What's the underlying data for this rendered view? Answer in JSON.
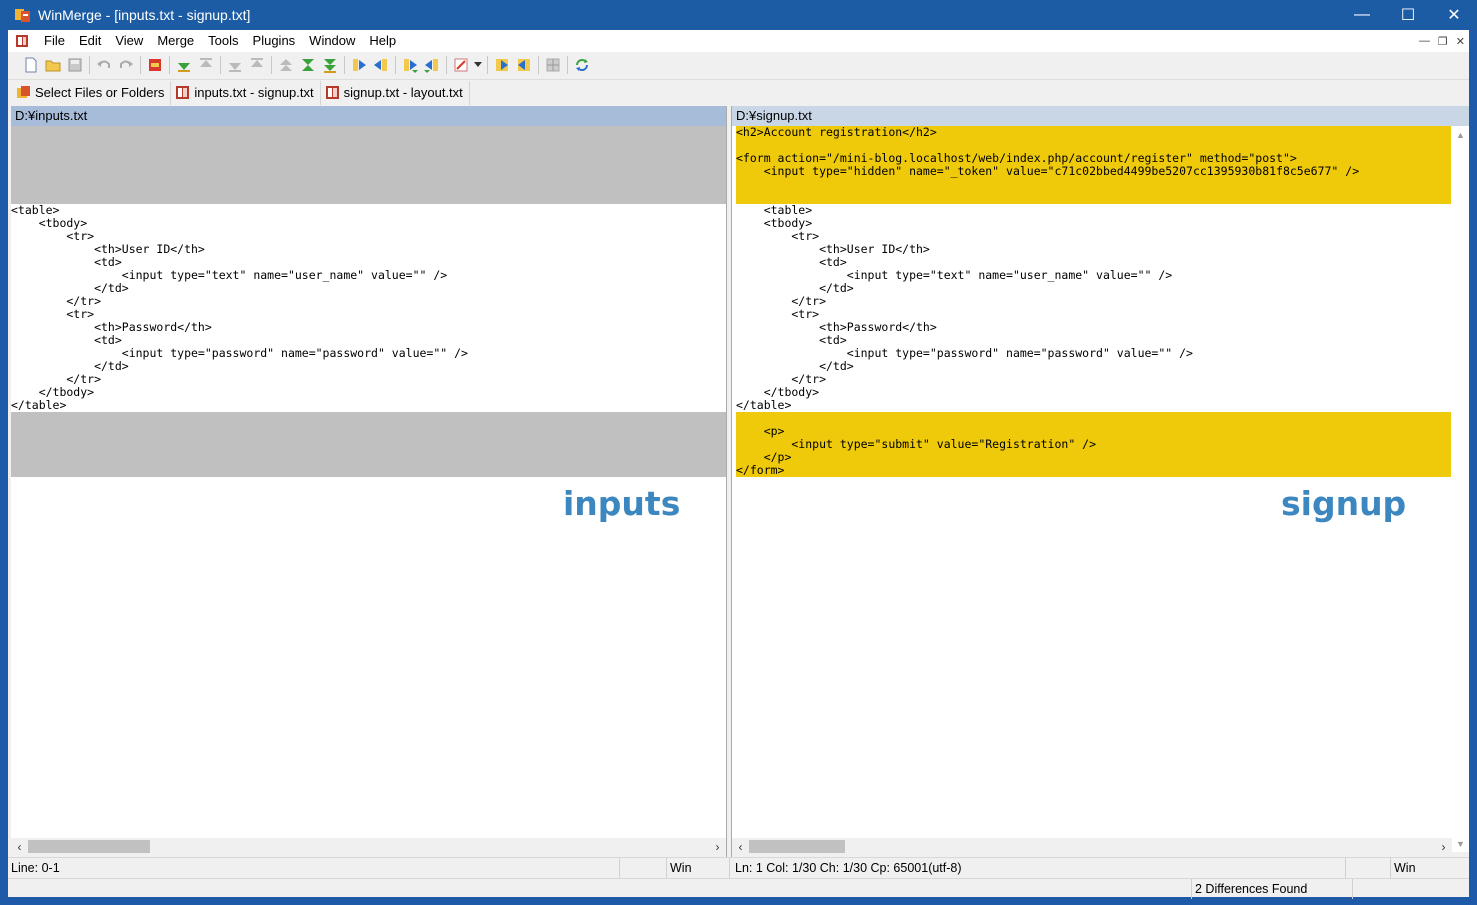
{
  "window": {
    "title": "WinMerge - [inputs.txt - signup.txt]",
    "controls": [
      "minimize",
      "maximize",
      "close"
    ]
  },
  "menu": [
    "File",
    "Edit",
    "View",
    "Merge",
    "Tools",
    "Plugins",
    "Window",
    "Help"
  ],
  "toolbar_icons": [
    "new-document-icon",
    "open-folder-icon",
    "save-icon",
    "undo-icon",
    "redo-icon",
    "options-icon",
    "next-diff-icon",
    "prev-diff-icon",
    "last-diff-icon",
    "first-diff-icon",
    "first-diff-alt-icon",
    "current-diff-icon",
    "last-diff-alt-icon",
    "copy-right-icon",
    "copy-left-icon",
    "copy-right-advance-icon",
    "copy-left-advance-icon",
    "all-right-icon",
    "all-left-icon",
    "auto-merge-icon",
    "refresh-icon"
  ],
  "tabs": [
    {
      "label": "Select Files or Folders",
      "icon": "open-files-icon"
    },
    {
      "label": "inputs.txt - signup.txt",
      "icon": "diff-document-icon"
    },
    {
      "label": "signup.txt - layout.txt",
      "icon": "diff-document-icon"
    }
  ],
  "left_pane": {
    "path": "D:¥inputs.txt",
    "label": "inputs",
    "lines": [
      {
        "t": "",
        "k": "gap"
      },
      {
        "t": "",
        "k": "gap"
      },
      {
        "t": "",
        "k": "gap"
      },
      {
        "t": "",
        "k": "gap"
      },
      {
        "t": "",
        "k": "gap"
      },
      {
        "t": "",
        "k": "gap"
      },
      {
        "t": "<table>",
        "k": ""
      },
      {
        "t": "    <tbody>",
        "k": ""
      },
      {
        "t": "        <tr>",
        "k": ""
      },
      {
        "t": "            <th>User ID</th>",
        "k": ""
      },
      {
        "t": "            <td>",
        "k": ""
      },
      {
        "t": "                <input type=\"text\" name=\"user_name\" value=\"\" />",
        "k": ""
      },
      {
        "t": "            </td>",
        "k": ""
      },
      {
        "t": "        </tr>",
        "k": ""
      },
      {
        "t": "        <tr>",
        "k": ""
      },
      {
        "t": "            <th>Password</th>",
        "k": ""
      },
      {
        "t": "            <td>",
        "k": ""
      },
      {
        "t": "                <input type=\"password\" name=\"password\" value=\"\" />",
        "k": ""
      },
      {
        "t": "            </td>",
        "k": ""
      },
      {
        "t": "        </tr>",
        "k": ""
      },
      {
        "t": "    </tbody>",
        "k": ""
      },
      {
        "t": "</table>",
        "k": ""
      },
      {
        "t": "",
        "k": "gap"
      },
      {
        "t": "",
        "k": "gap"
      },
      {
        "t": "",
        "k": "gap"
      },
      {
        "t": "",
        "k": "gap"
      },
      {
        "t": "",
        "k": "gap"
      }
    ]
  },
  "right_pane": {
    "path": "D:¥signup.txt",
    "label": "signup",
    "lines": [
      {
        "t": "<h2>Account registration</h2>",
        "k": "diff"
      },
      {
        "t": "",
        "k": "diff"
      },
      {
        "t": "<form action=\"/mini-blog.localhost/web/index.php/account/register\" method=\"post\">",
        "k": "diff"
      },
      {
        "t": "    <input type=\"hidden\" name=\"_token\" value=\"c71c02bbed4499be5207cc1395930b81f8c5e677\" />",
        "k": "diff"
      },
      {
        "t": "",
        "k": "diff"
      },
      {
        "t": "",
        "k": "diff"
      },
      {
        "t": "    <table>",
        "k": ""
      },
      {
        "t": "    <tbody>",
        "k": ""
      },
      {
        "t": "        <tr>",
        "k": ""
      },
      {
        "t": "            <th>User ID</th>",
        "k": ""
      },
      {
        "t": "            <td>",
        "k": ""
      },
      {
        "t": "                <input type=\"text\" name=\"user_name\" value=\"\" />",
        "k": ""
      },
      {
        "t": "            </td>",
        "k": ""
      },
      {
        "t": "        </tr>",
        "k": ""
      },
      {
        "t": "        <tr>",
        "k": ""
      },
      {
        "t": "            <th>Password</th>",
        "k": ""
      },
      {
        "t": "            <td>",
        "k": ""
      },
      {
        "t": "                <input type=\"password\" name=\"password\" value=\"\" />",
        "k": ""
      },
      {
        "t": "            </td>",
        "k": ""
      },
      {
        "t": "        </tr>",
        "k": ""
      },
      {
        "t": "    </tbody>",
        "k": ""
      },
      {
        "t": "</table>",
        "k": ""
      },
      {
        "t": "",
        "k": "diff"
      },
      {
        "t": "    <p>",
        "k": "diff"
      },
      {
        "t": "        <input type=\"submit\" value=\"Registration\" />",
        "k": "diff"
      },
      {
        "t": "    </p>",
        "k": "diff"
      },
      {
        "t": "</form>",
        "k": "diff"
      }
    ]
  },
  "status": {
    "left_line": "Line: 0-1",
    "left_eol": "Win",
    "right_pos": "Ln: 1  Col: 1/30  Ch: 1/30  Cp: 65001(utf-8)",
    "right_eol": "Win",
    "differences": "2 Differences Found"
  },
  "colors": {
    "diff": "#efca0a",
    "gap": "#c0c0c0",
    "title_bar": "#1b5ca4",
    "label": "#3d87c0"
  }
}
